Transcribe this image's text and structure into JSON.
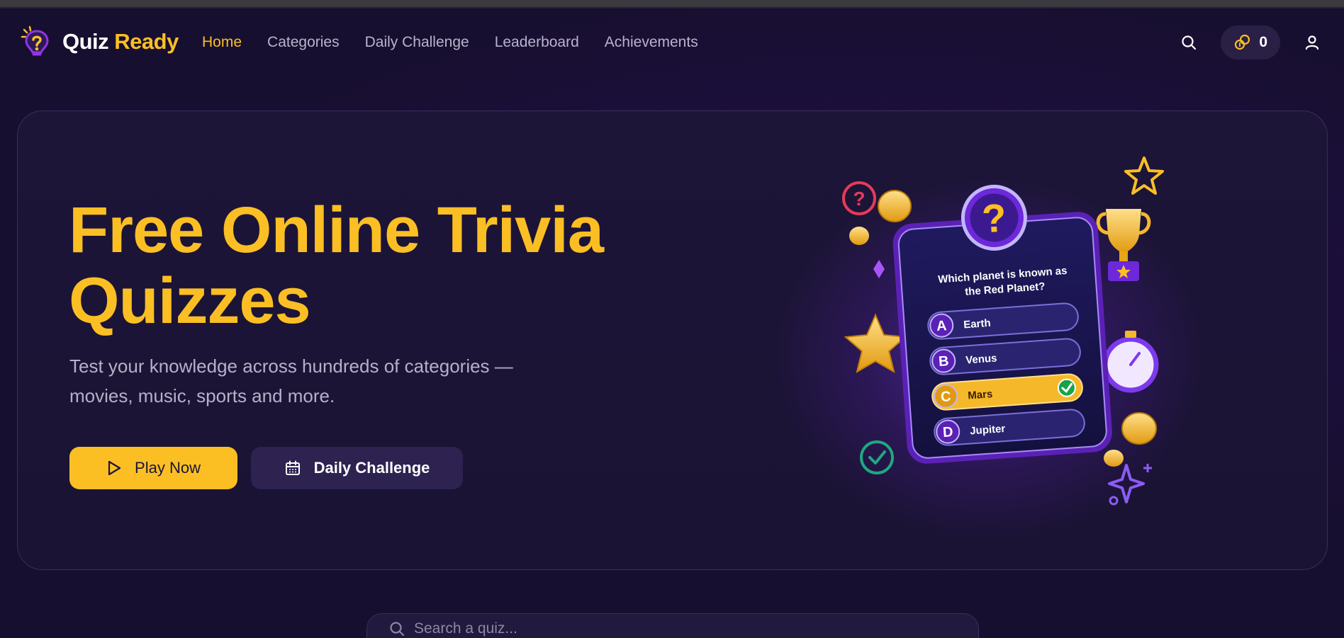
{
  "brand": {
    "word1": "Quiz",
    "word2": "Ready"
  },
  "nav": {
    "items": [
      {
        "label": "Home",
        "active": true
      },
      {
        "label": "Categories",
        "active": false
      },
      {
        "label": "Daily Challenge",
        "active": false
      },
      {
        "label": "Leaderboard",
        "active": false
      },
      {
        "label": "Achievements",
        "active": false
      }
    ]
  },
  "header": {
    "coins": "0",
    "icons": [
      "search-icon",
      "coins-icon",
      "user-icon"
    ]
  },
  "hero": {
    "title": "Free Online Trivia Quizzes",
    "subtitle": "Test your knowledge across hundreds of categories — movies, music, sports and more.",
    "play_label": "Play Now",
    "daily_label": "Daily Challenge"
  },
  "illustration": {
    "question": "Which planet is known as the Red Planet?",
    "options": [
      {
        "letter": "A",
        "text": "Earth",
        "correct": false
      },
      {
        "letter": "B",
        "text": "Venus",
        "correct": false
      },
      {
        "letter": "C",
        "text": "Mars",
        "correct": true
      },
      {
        "letter": "D",
        "text": "Jupiter",
        "correct": false
      }
    ]
  },
  "search": {
    "placeholder": "Search a quiz..."
  },
  "colors": {
    "accent": "#fbbf24",
    "background": "#170f30",
    "purple": "#7c3aed"
  }
}
